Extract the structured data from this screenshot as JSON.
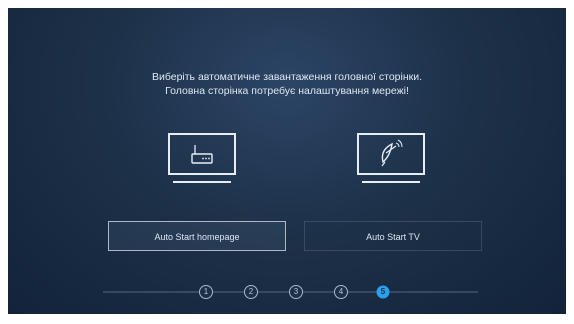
{
  "heading": {
    "line1": "Виберіть автоматичне завантаження головної сторінки.",
    "line2": "Головна сторінка потребує налаштування мережі!"
  },
  "options": [
    {
      "label": "Auto Start homepage",
      "icon": "tv-router-icon",
      "selected": true
    },
    {
      "label": "Auto Start TV",
      "icon": "tv-satellite-icon",
      "selected": false
    }
  ],
  "steps": {
    "labels": [
      "1",
      "2",
      "3",
      "4",
      "5"
    ],
    "current": 5
  },
  "colors": {
    "background_top": "#2c4566",
    "background_bottom": "#12233a",
    "accent": "#2aa0ea"
  }
}
